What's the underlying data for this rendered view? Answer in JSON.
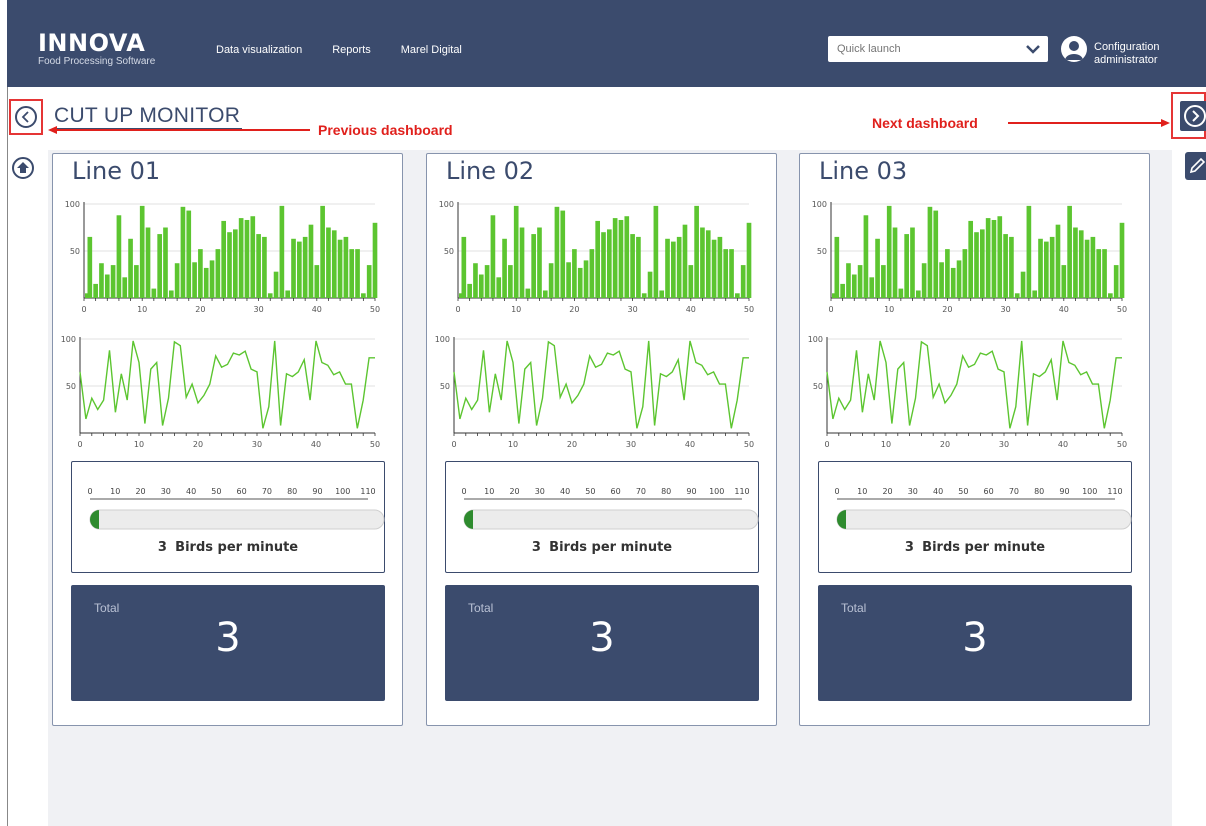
{
  "app": {
    "brand": "INNOVA",
    "brand_sub": "Food Processing Software"
  },
  "nav": [
    {
      "label": "Data visualization"
    },
    {
      "label": "Reports"
    },
    {
      "label": "Marel Digital"
    }
  ],
  "quick_launch": {
    "placeholder": "Quick launch",
    "value": ""
  },
  "user": {
    "line1": "Configuration",
    "line2": "administrator"
  },
  "page": {
    "title": "CUT UP MONITOR"
  },
  "annotations": {
    "prev": "Previous dashboard",
    "next": "Next dashboard"
  },
  "colors": {
    "header": "#3b4b6d",
    "accent": "#5cc530",
    "gauge": "#2e8b2e",
    "annotation": "#e0201c"
  },
  "icons": {
    "prev": "chevron-left-circle-icon",
    "next": "chevron-right-circle-icon",
    "home": "home-up-icon",
    "edit": "pencil-icon",
    "user": "user-avatar-icon",
    "dropdown": "chevron-down-icon"
  },
  "panels": [
    {
      "title": "Line 01",
      "gauge_value": "3",
      "gauge_unit": "Birds per minute",
      "total_label": "Total",
      "total_value": "3"
    },
    {
      "title": "Line 02",
      "gauge_value": "3",
      "gauge_unit": "Birds per minute",
      "total_label": "Total",
      "total_value": "3"
    },
    {
      "title": "Line 03",
      "gauge_value": "3",
      "gauge_unit": "Birds per minute",
      "total_label": "Total",
      "total_value": "3"
    }
  ],
  "chart_data": [
    {
      "type": "bar",
      "x": [
        0,
        1,
        2,
        3,
        4,
        5,
        6,
        7,
        8,
        9,
        10,
        11,
        12,
        13,
        14,
        15,
        16,
        17,
        18,
        19,
        20,
        21,
        22,
        23,
        24,
        25,
        26,
        27,
        28,
        29,
        30,
        31,
        32,
        33,
        34,
        35,
        36,
        37,
        38,
        39,
        40,
        41,
        42,
        43,
        44,
        45,
        46,
        47,
        48,
        49,
        50
      ],
      "values": [
        5,
        65,
        15,
        37,
        25,
        35,
        88,
        22,
        63,
        35,
        98,
        75,
        10,
        68,
        75,
        8,
        37,
        97,
        93,
        38,
        52,
        32,
        40,
        52,
        82,
        70,
        73,
        85,
        83,
        87,
        68,
        65,
        5,
        28,
        98,
        8,
        63,
        60,
        65,
        78,
        35,
        98,
        75,
        72,
        62,
        65,
        52,
        52,
        5,
        35,
        80
      ],
      "xlim": [
        0,
        50
      ],
      "ylim": [
        0,
        100
      ],
      "xticks": [
        0,
        10,
        20,
        30,
        40,
        50
      ],
      "yticks": [
        50,
        100
      ],
      "grid": true,
      "panels": [
        "Line 01",
        "Line 02",
        "Line 03"
      ]
    },
    {
      "type": "line",
      "x": [
        0,
        1,
        2,
        3,
        4,
        5,
        6,
        7,
        8,
        9,
        10,
        11,
        12,
        13,
        14,
        15,
        16,
        17,
        18,
        19,
        20,
        21,
        22,
        23,
        24,
        25,
        26,
        27,
        28,
        29,
        30,
        31,
        32,
        33,
        34,
        35,
        36,
        37,
        38,
        39,
        40,
        41,
        42,
        43,
        44,
        45,
        46,
        47,
        48,
        49,
        50
      ],
      "values": [
        65,
        15,
        37,
        25,
        35,
        88,
        22,
        63,
        35,
        98,
        75,
        10,
        68,
        75,
        8,
        37,
        97,
        93,
        38,
        52,
        32,
        40,
        52,
        82,
        70,
        73,
        85,
        83,
        87,
        68,
        65,
        5,
        28,
        98,
        8,
        63,
        60,
        65,
        78,
        35,
        98,
        75,
        72,
        62,
        65,
        52,
        52,
        5,
        35,
        80,
        80
      ],
      "xlim": [
        0,
        50
      ],
      "ylim": [
        0,
        100
      ],
      "xticks": [
        0,
        10,
        20,
        30,
        40,
        50
      ],
      "yticks": [
        50,
        100
      ],
      "grid": true,
      "panels": [
        "Line 01",
        "Line 02",
        "Line 03"
      ]
    },
    {
      "type": "bar",
      "orientation": "horizontal",
      "value": 3,
      "xlim": [
        0,
        110
      ],
      "xticks": [
        0,
        10,
        20,
        30,
        40,
        50,
        60,
        70,
        80,
        90,
        100,
        110
      ],
      "panels": [
        "Line 01",
        "Line 02",
        "Line 03"
      ]
    }
  ]
}
